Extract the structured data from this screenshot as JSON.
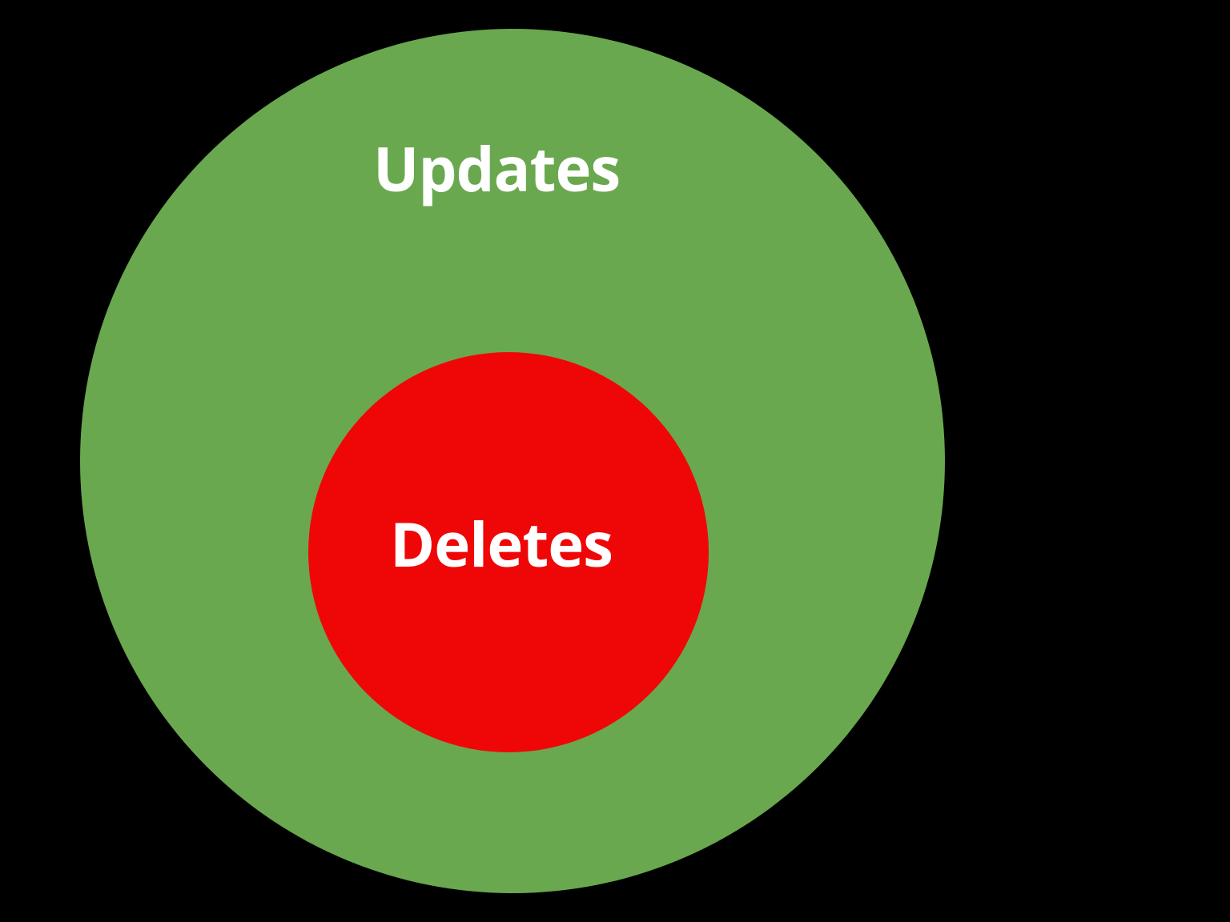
{
  "chart_data": {
    "type": "venn-nested",
    "title": "",
    "sets": [
      {
        "name": "outer",
        "label": "Updates",
        "color": "#6aa84f",
        "radius_ratio": 1.0
      },
      {
        "name": "inner",
        "label": "Deletes",
        "color": "#ef0707",
        "radius_ratio": 0.46,
        "subset_of": "outer"
      }
    ]
  }
}
